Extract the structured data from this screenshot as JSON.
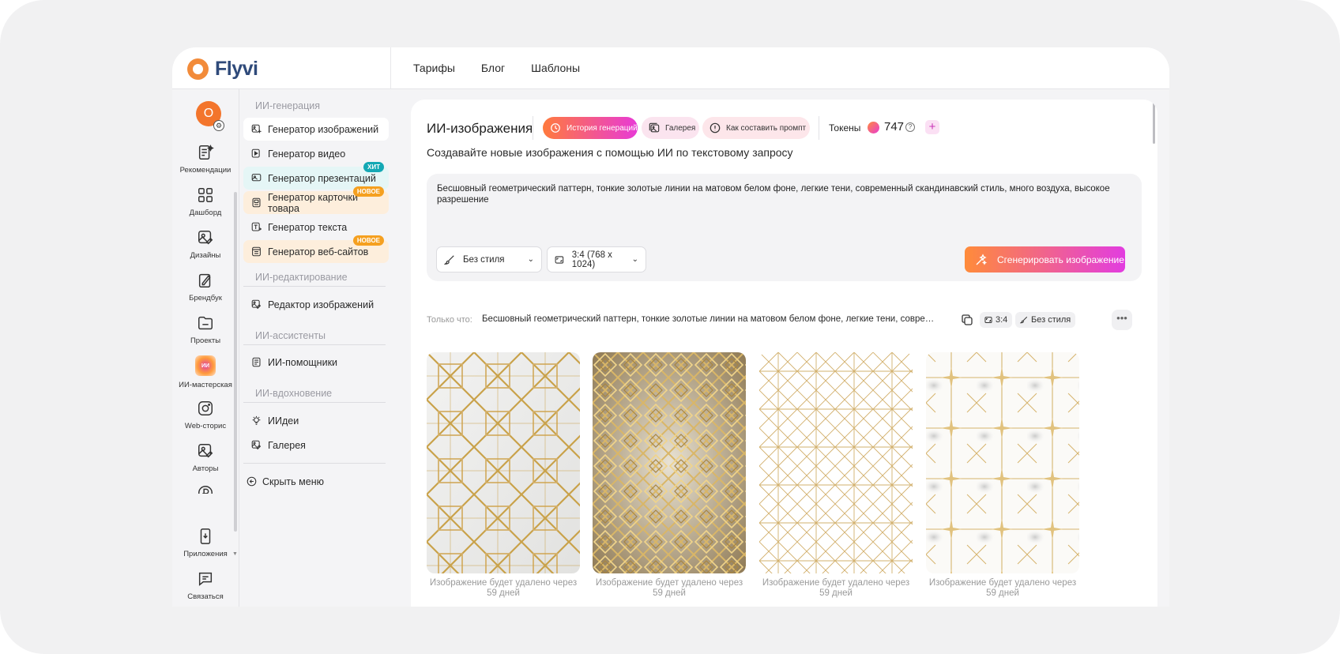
{
  "brand": {
    "name": "Flyvi"
  },
  "topnav": {
    "items": [
      "Тарифы",
      "Блог",
      "Шаблоны"
    ]
  },
  "user": {
    "initial": "О"
  },
  "rail": {
    "items": [
      {
        "label": "Рекомендации",
        "icon": "recommendations-icon"
      },
      {
        "label": "Дашборд",
        "icon": "dashboard-icon"
      },
      {
        "label": "Дизайны",
        "icon": "designs-icon"
      },
      {
        "label": "Брендбук",
        "icon": "brandbook-icon"
      },
      {
        "label": "Проекты",
        "icon": "folder-icon"
      },
      {
        "label": "ИИ-мастерская",
        "icon": "ai-workshop-icon",
        "badge": "ИИ"
      },
      {
        "label": "Web-сторис",
        "icon": "web-stories-icon"
      },
      {
        "label": "Авторы",
        "icon": "authors-icon"
      }
    ],
    "bottom": [
      {
        "label": "Приложения",
        "icon": "apps-icon"
      },
      {
        "label": "Связаться",
        "icon": "chat-icon"
      }
    ]
  },
  "menu": {
    "sections": [
      {
        "title": "ИИ-генерация",
        "items": [
          {
            "label": "Генератор изображений",
            "active": true
          },
          {
            "label": "Генератор видео"
          },
          {
            "label": "Генератор презентаций",
            "tag": "ХИТ"
          },
          {
            "label": "Генератор карточки товара",
            "tag": "НОВОЕ"
          },
          {
            "label": "Генератор текста"
          },
          {
            "label": "Генератор веб-сайтов",
            "tag": "НОВОЕ"
          }
        ]
      },
      {
        "title": "ИИ-редактирование",
        "items": [
          {
            "label": "Редактор изображений"
          }
        ]
      },
      {
        "title": "ИИ-ассистенты",
        "items": [
          {
            "label": "ИИ-помощники"
          }
        ]
      },
      {
        "title": "ИИ-вдохновение",
        "items": [
          {
            "label": "ИИдеи"
          },
          {
            "label": "Галерея"
          }
        ]
      }
    ],
    "hide_label": "Скрыть меню"
  },
  "main": {
    "title": "ИИ-изображения",
    "pills": {
      "history": "История генераций",
      "gallery": "Галерея",
      "howto": "Как составить промпт"
    },
    "tokens": {
      "label": "Токены",
      "value": "747"
    },
    "subtitle": "Создавайте новые изображения с помощью ИИ по текстовому запросу",
    "prompt": "Бесшовный геометрический паттерн, тонкие золотые линии на матовом белом фоне, легкие тени, современный скандинавский стиль, много воздуха, высокое разрешение",
    "style_select": "Без стиля",
    "ratio_select": "3:4 (768 x 1024)",
    "generate_label": "Сгенерировать изображение",
    "result": {
      "just_label": "Только что:",
      "prompt": "Бесшовный геометрический паттерн, тонкие золотые линии на матовом белом фоне, легкие тени, современный скандинавский стиль, много воздуха, высокое разрешение",
      "ratio_chip": "3:4",
      "style_chip": "Без стиля",
      "more": "•••"
    },
    "images": [
      {
        "caption": "Изображение будет удалено через 59 дней"
      },
      {
        "caption": "Изображение будет удалено через 59 дней"
      },
      {
        "caption": "Изображение будет удалено через 59 дней"
      },
      {
        "caption": "Изображение будет удалено через 59 дней"
      }
    ]
  },
  "colors": {
    "accent": "#f3752c",
    "gradient_start": "#ff8b3a",
    "gradient_end": "#e23ce0",
    "hit": "#14a8b4",
    "new": "#f5a020",
    "gold": "#c9a24a"
  }
}
